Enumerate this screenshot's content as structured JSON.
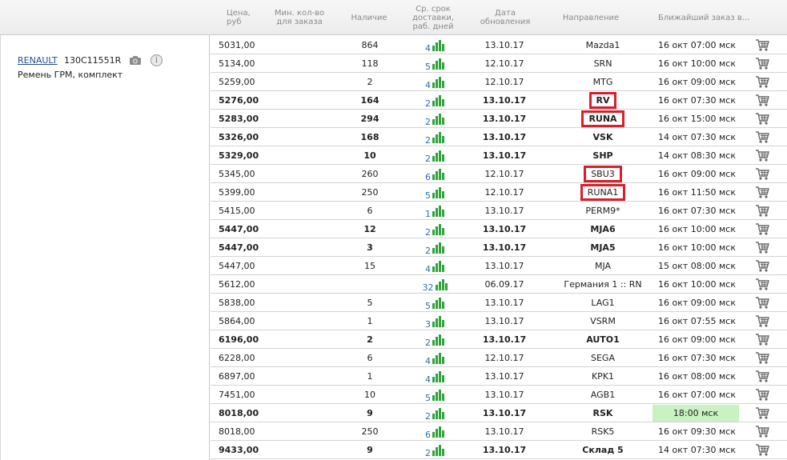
{
  "headers": {
    "price": "Цена,\nруб",
    "min_qty": "Мин. кол-во\nдля заказа",
    "stock": "Наличие",
    "days": "Ср. срок\nдоставки,\nраб. дней",
    "updated": "Дата\nобновления",
    "direction": "Направление",
    "nearest": "Ближайший заказ в..."
  },
  "product": {
    "brand": "RENAULT",
    "part_number": "130C11551R",
    "description": "Ремень ГРМ, комплект",
    "camera_icon": "camera-icon",
    "info_icon": "info-icon",
    "info_glyph": "i"
  },
  "colors": {
    "highlight_border": "#d6202a",
    "green_badge": "#c9f1c2",
    "bars": "#2fa43a",
    "link": "#1f4f8f"
  },
  "rows": [
    {
      "price": "5031,00",
      "min": "",
      "stock": "864",
      "days": "4",
      "updated": "13.10.17",
      "direction": "Mazda1",
      "nearest": "16 окт 07:00 мск",
      "bold": false,
      "hl": false
    },
    {
      "price": "5134,00",
      "min": "",
      "stock": "118",
      "days": "5",
      "updated": "12.10.17",
      "direction": "SRN",
      "nearest": "16 окт 10:00 мск",
      "bold": false,
      "hl": false
    },
    {
      "price": "5259,00",
      "min": "",
      "stock": "2",
      "days": "4",
      "updated": "12.10.17",
      "direction": "MTG",
      "nearest": "16 окт 09:00 мск",
      "bold": false,
      "hl": false
    },
    {
      "price": "5276,00",
      "min": "",
      "stock": "164",
      "days": "2",
      "updated": "13.10.17",
      "direction": "RV",
      "nearest": "16 окт 07:30 мск",
      "bold": true,
      "hl": true
    },
    {
      "price": "5283,00",
      "min": "",
      "stock": "294",
      "days": "2",
      "updated": "13.10.17",
      "direction": "RUNA",
      "nearest": "16 окт 15:00 мск",
      "bold": true,
      "hl": true
    },
    {
      "price": "5326,00",
      "min": "",
      "stock": "168",
      "days": "2",
      "updated": "13.10.17",
      "direction": "VSK",
      "nearest": "14 окт 07:30 мск",
      "bold": true,
      "hl": false
    },
    {
      "price": "5329,00",
      "min": "",
      "stock": "10",
      "days": "2",
      "updated": "13.10.17",
      "direction": "SHP",
      "nearest": "14 окт 08:30 мск",
      "bold": true,
      "hl": false
    },
    {
      "price": "5345,00",
      "min": "",
      "stock": "260",
      "days": "6",
      "updated": "12.10.17",
      "direction": "SBU3",
      "nearest": "16 окт 09:00 мск",
      "bold": false,
      "hl": true
    },
    {
      "price": "5399,00",
      "min": "",
      "stock": "250",
      "days": "5",
      "updated": "12.10.17",
      "direction": "RUNA1",
      "nearest": "16 окт 11:50 мск",
      "bold": false,
      "hl": true
    },
    {
      "price": "5415,00",
      "min": "",
      "stock": "6",
      "days": "1",
      "updated": "13.10.17",
      "direction": "PERM9*",
      "nearest": "16 окт 07:30 мск",
      "bold": false,
      "hl": false
    },
    {
      "price": "5447,00",
      "min": "",
      "stock": "12",
      "days": "2",
      "updated": "13.10.17",
      "direction": "MJA6",
      "nearest": "16 окт 10:00 мск",
      "bold": true,
      "hl": false
    },
    {
      "price": "5447,00",
      "min": "",
      "stock": "3",
      "days": "2",
      "updated": "13.10.17",
      "direction": "MJA5",
      "nearest": "16 окт 10:00 мск",
      "bold": true,
      "hl": false
    },
    {
      "price": "5447,00",
      "min": "",
      "stock": "15",
      "days": "4",
      "updated": "13.10.17",
      "direction": "MJA",
      "nearest": "15 окт 08:00 мск",
      "bold": false,
      "hl": false
    },
    {
      "price": "5612,00",
      "min": "",
      "stock": "",
      "days": "32",
      "updated": "06.09.17",
      "direction": "Германия 1 :: RN",
      "nearest": "16 окт 10:00 мск",
      "bold": false,
      "hl": false
    },
    {
      "price": "5838,00",
      "min": "",
      "stock": "5",
      "days": "5",
      "updated": "13.10.17",
      "direction": "LAG1",
      "nearest": "16 окт 09:00 мск",
      "bold": false,
      "hl": false
    },
    {
      "price": "5864,00",
      "min": "",
      "stock": "1",
      "days": "3",
      "updated": "13.10.17",
      "direction": "VSRM",
      "nearest": "16 окт 07:55 мск",
      "bold": false,
      "hl": false
    },
    {
      "price": "6196,00",
      "min": "",
      "stock": "2",
      "days": "2",
      "updated": "13.10.17",
      "direction": "AUTO1",
      "nearest": "16 окт 09:00 мск",
      "bold": true,
      "hl": false
    },
    {
      "price": "6228,00",
      "min": "",
      "stock": "6",
      "days": "4",
      "updated": "12.10.17",
      "direction": "SEGA",
      "nearest": "16 окт 07:30 мск",
      "bold": false,
      "hl": false
    },
    {
      "price": "6897,00",
      "min": "",
      "stock": "1",
      "days": "4",
      "updated": "13.10.17",
      "direction": "KPK1",
      "nearest": "16 окт 08:00 мск",
      "bold": false,
      "hl": false
    },
    {
      "price": "7451,00",
      "min": "",
      "stock": "10",
      "days": "5",
      "updated": "13.10.17",
      "direction": "AGB1",
      "nearest": "16 окт 07:00 мск",
      "bold": false,
      "hl": false
    },
    {
      "price": "8018,00",
      "min": "",
      "stock": "9",
      "days": "2",
      "updated": "13.10.17",
      "direction": "RSK",
      "nearest": "18:00 мск",
      "bold": true,
      "hl": false,
      "green": true
    },
    {
      "price": "8018,00",
      "min": "",
      "stock": "250",
      "days": "6",
      "updated": "13.10.17",
      "direction": "RSK5",
      "nearest": "16 окт 09:30 мск",
      "bold": false,
      "hl": false
    },
    {
      "price": "9433,00",
      "min": "",
      "stock": "9",
      "days": "2",
      "updated": "13.10.17",
      "direction": "Склад 5",
      "nearest": "14 окт 07:30 мск",
      "bold": true,
      "hl": false
    }
  ]
}
